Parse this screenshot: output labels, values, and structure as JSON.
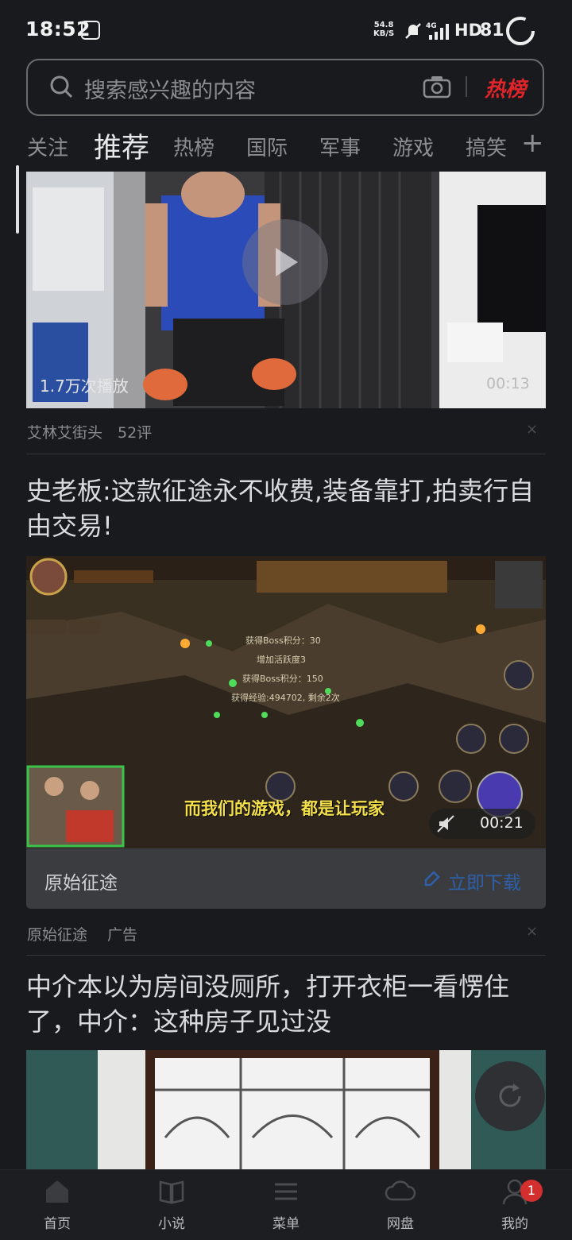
{
  "status_bar": {
    "time": "18:52",
    "net_speed_value": "54.8",
    "net_speed_unit": "KB/S",
    "network": "4G",
    "hd": "HD",
    "battery": "81"
  },
  "search": {
    "placeholder": "搜索感兴趣的内容",
    "hot_label": "热榜"
  },
  "tabs": [
    "关注",
    "推荐",
    "热榜",
    "国际",
    "军事",
    "游戏",
    "搞笑"
  ],
  "active_tab": "推荐",
  "feed": {
    "video1": {
      "play_count": "1.7万次播放",
      "duration": "00:13",
      "source": "艾林艾街头",
      "comments": "52评"
    },
    "ad": {
      "title": "史老板:这款征途永不收费,装备靠打,拍卖行自由交易!",
      "duration": "00:21",
      "subtitle": "而我们的游戏，都是让玩家",
      "app_name": "原始征途",
      "download_label": "立即下载",
      "source": "原始征途",
      "ad_label": "广告"
    },
    "article2": {
      "title": "中介本以为房间没厕所，打开衣柜一看愣住了，中介：这种房子见过没"
    }
  },
  "bottom_nav": [
    {
      "label": "首页",
      "icon": "home-icon"
    },
    {
      "label": "小说",
      "icon": "book-icon"
    },
    {
      "label": "菜单",
      "icon": "menu-icon"
    },
    {
      "label": "网盘",
      "icon": "cloud-icon"
    },
    {
      "label": "我的",
      "icon": "profile-icon",
      "badge": "1"
    }
  ],
  "colors": {
    "background": "#181a1e",
    "hot": "#e0252a",
    "link": "#2f5fa8",
    "badge": "#d32f2f"
  }
}
